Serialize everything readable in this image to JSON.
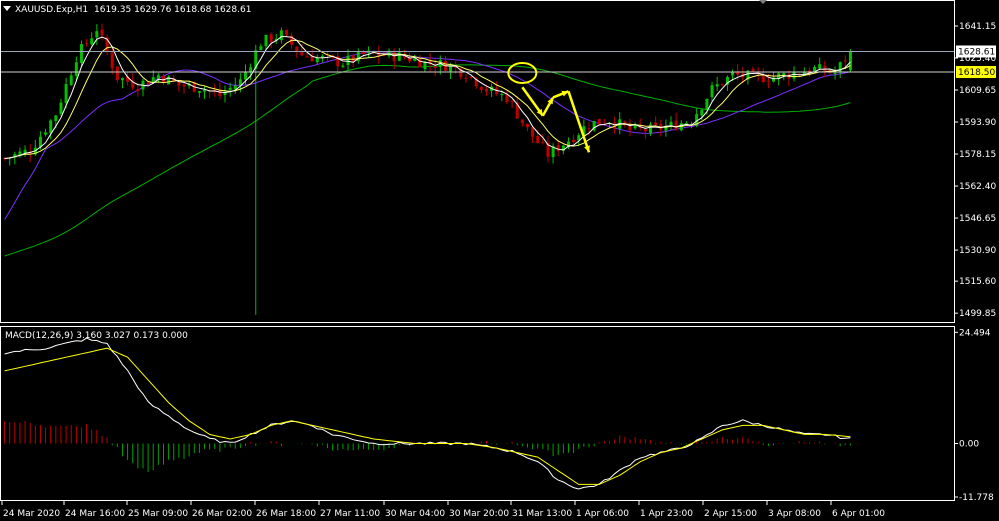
{
  "window": {
    "title": "XAUUSD.Exp,H1",
    "ohlc": "1619.35 1629.76 1618.68 1628.61",
    "menu_icon": "triangle-down-icon"
  },
  "colors": {
    "background": "#000000",
    "axis": "#ffffff",
    "bull_candle": "#00c000",
    "bear_candle": "#c00000",
    "ma_fast": "#ffffff",
    "ma_mid": "#ffff66",
    "ma_slow": "#7b2fff",
    "ma_long": "#00b000",
    "macd_main": "#ffffff",
    "macd_signal": "#ffff00",
    "hist_pos": "#c00000",
    "hist_neg": "#00a000",
    "annotation": "#ffff00",
    "current_price_bg": "#ffff00"
  },
  "chart_data": [
    {
      "type": "candlestick",
      "title": "XAUUSD.Exp,H1",
      "ylim": [
        1496.0,
        1650.0
      ],
      "y_ticks": [
        "1641.15",
        "1625.40",
        "1609.65",
        "1593.90",
        "1578.15",
        "1562.40",
        "1546.65",
        "1530.90",
        "1515.60",
        "1499.85"
      ],
      "price_labels": {
        "bid": "1628.61",
        "current": "1618.50"
      },
      "x_ticks": [
        "24 Mar 2020",
        "24 Mar 16:00",
        "25 Mar 09:00",
        "26 Mar 02:00",
        "26 Mar 18:00",
        "27 Mar 11:00",
        "30 Mar 04:00",
        "30 Mar 20:00",
        "31 Mar 13:00",
        "1 Apr 06:00",
        "1 Apr 23:00",
        "2 Apr 15:00",
        "3 Apr 08:00",
        "6 Apr 01:00"
      ],
      "price_path": [
        [
          0,
          1576
        ],
        [
          5,
          1580
        ],
        [
          10,
          1598
        ],
        [
          14,
          1626
        ],
        [
          18,
          1640
        ],
        [
          22,
          1616
        ],
        [
          26,
          1612
        ],
        [
          30,
          1617
        ],
        [
          34,
          1612
        ],
        [
          38,
          1611
        ],
        [
          42,
          1607
        ],
        [
          46,
          1614
        ],
        [
          50,
          1633
        ],
        [
          54,
          1637
        ],
        [
          58,
          1627
        ],
        [
          62,
          1625
        ],
        [
          66,
          1623
        ],
        [
          70,
          1627
        ],
        [
          74,
          1627
        ],
        [
          78,
          1626
        ],
        [
          82,
          1623
        ],
        [
          86,
          1622
        ],
        [
          90,
          1618
        ],
        [
          94,
          1610
        ],
        [
          98,
          1606
        ],
        [
          102,
          1590
        ],
        [
          106,
          1578
        ],
        [
          110,
          1585
        ],
        [
          114,
          1593
        ],
        [
          118,
          1595
        ],
        [
          122,
          1590
        ],
        [
          126,
          1590
        ],
        [
          130,
          1592
        ],
        [
          134,
          1595
        ],
        [
          138,
          1610
        ],
        [
          142,
          1617
        ],
        [
          146,
          1616
        ],
        [
          150,
          1616
        ],
        [
          154,
          1618
        ],
        [
          158,
          1620
        ],
        [
          162,
          1618
        ],
        [
          165,
          1628.61
        ]
      ],
      "spike": {
        "at": 49,
        "low": 1499.0
      },
      "annotations": {
        "circle_at": [
          101,
          1618
        ],
        "arrows": [
          [
            [
              101,
              1611
            ],
            [
              105,
              1597
            ]
          ],
          [
            [
              105,
              1597
            ],
            [
              107,
              1606
            ]
          ],
          [
            [
              107,
              1606
            ],
            [
              110,
              1609
            ]
          ],
          [
            [
              110,
              1609
            ],
            [
              114,
              1579
            ]
          ]
        ]
      }
    },
    {
      "type": "macd",
      "title": "MACD(12,26,9) 3.160 3.027 0.173 0.000",
      "ylim": [
        -12.0,
        25.0
      ],
      "y_ticks": [
        "24.494",
        "0.00",
        "-11.778"
      ],
      "main": [
        [
          0,
          20
        ],
        [
          8,
          21
        ],
        [
          16,
          23
        ],
        [
          20,
          22
        ],
        [
          24,
          16
        ],
        [
          28,
          9
        ],
        [
          32,
          6
        ],
        [
          36,
          3
        ],
        [
          40,
          1
        ],
        [
          44,
          0
        ],
        [
          48,
          2
        ],
        [
          52,
          4
        ],
        [
          56,
          5
        ],
        [
          60,
          4
        ],
        [
          64,
          2
        ],
        [
          68,
          1
        ],
        [
          72,
          0
        ],
        [
          80,
          0
        ],
        [
          90,
          0
        ],
        [
          96,
          -1
        ],
        [
          100,
          -2
        ],
        [
          104,
          -4
        ],
        [
          108,
          -8
        ],
        [
          112,
          -10
        ],
        [
          116,
          -9
        ],
        [
          120,
          -6
        ],
        [
          124,
          -3
        ],
        [
          128,
          -2
        ],
        [
          132,
          -1
        ],
        [
          136,
          1
        ],
        [
          140,
          4
        ],
        [
          144,
          5
        ],
        [
          148,
          4
        ],
        [
          152,
          3
        ],
        [
          156,
          2
        ],
        [
          160,
          2
        ],
        [
          165,
          1
        ]
      ],
      "signal": [
        [
          0,
          16
        ],
        [
          8,
          18
        ],
        [
          16,
          20
        ],
        [
          20,
          21
        ],
        [
          24,
          19
        ],
        [
          28,
          14
        ],
        [
          32,
          9
        ],
        [
          36,
          5
        ],
        [
          40,
          2
        ],
        [
          44,
          1
        ],
        [
          48,
          2
        ],
        [
          52,
          4
        ],
        [
          56,
          5
        ],
        [
          60,
          4
        ],
        [
          64,
          3
        ],
        [
          68,
          2
        ],
        [
          72,
          1
        ],
        [
          80,
          0
        ],
        [
          90,
          0
        ],
        [
          96,
          -1
        ],
        [
          100,
          -2
        ],
        [
          104,
          -3
        ],
        [
          108,
          -6
        ],
        [
          112,
          -9
        ],
        [
          116,
          -9
        ],
        [
          120,
          -7
        ],
        [
          124,
          -4
        ],
        [
          128,
          -2
        ],
        [
          132,
          -1
        ],
        [
          136,
          1
        ],
        [
          140,
          3
        ],
        [
          144,
          4
        ],
        [
          148,
          4
        ],
        [
          152,
          3
        ],
        [
          156,
          2
        ],
        [
          160,
          2
        ],
        [
          165,
          1.5
        ]
      ]
    }
  ]
}
